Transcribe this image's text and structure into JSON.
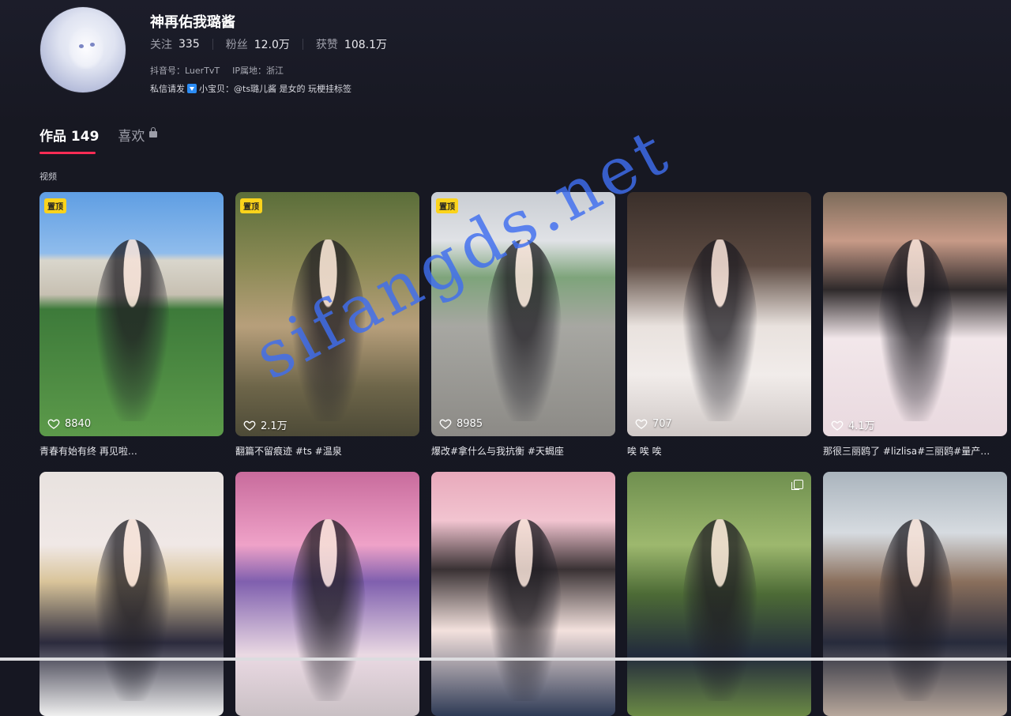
{
  "profile": {
    "nickname": "神再佑我璐酱",
    "stats": [
      {
        "label": "关注",
        "value": "335"
      },
      {
        "label": "粉丝",
        "value": "12.0万"
      },
      {
        "label": "获赞",
        "value": "108.1万"
      }
    ],
    "douyin_id": "抖音号：LuerTvT",
    "ip_location": "IP属地：浙江",
    "bio_prefix": "私信请发",
    "bio_suffix": "小宝贝：@ts璐儿酱 是女的 玩梗挂标签"
  },
  "tabs": {
    "works": "作品 149",
    "likes": "喜欢"
  },
  "section_label": "视频",
  "pin_label": "置顶",
  "videos": [
    {
      "likes": "8840",
      "caption": "青春有始有终 再见啦…",
      "pinned": true,
      "bg": "linear-gradient(180deg,#5f9ee3 0%,#8fbcec 25%,#d9d6cc 28%,#c7c0b2 42%,#3d7a3a 48%,#5c9a4a 100%)"
    },
    {
      "likes": "2.1万",
      "caption": "翻篇不留痕迹 #ts #温泉",
      "pinned": true,
      "bg": "linear-gradient(180deg,#5b6e3a 0%,#8b8a55 30%,#b79f7b 55%,#6d6549 80%,#4d4a37 100%)"
    },
    {
      "likes": "8985",
      "caption": "爆改#拿什么与我抗衡 #天蝎座",
      "pinned": true,
      "bg": "linear-gradient(180deg,#c9cdd3 0%,#e0e2e6 20%,#7ea47b 35%,#a7a7a2 55%,#8c8a86 100%)"
    },
    {
      "likes": "707",
      "caption": "唉 唉 唉",
      "pinned": false,
      "bg": "linear-gradient(180deg,#3a2f2a 0%,#5d4b42 30%,#e9e2de 55%,#f1ecea 75%,#cfc8c6 100%)"
    },
    {
      "likes": "4.1万",
      "caption": "那很三丽鸥了 #lizlisa#三丽鸥#量产…",
      "pinned": false,
      "bg": "linear-gradient(180deg,#7c6b5a 0%,#c79a87 20%,#2f2a2b 40%,#f2e7ea 60%,#e9d9df 100%)"
    },
    {
      "likes": "",
      "caption": "",
      "pinned": false,
      "bg": "linear-gradient(180deg,#e8e2df 0%,#f0e8e6 30%,#d9c49a 45%,#2c2b3d 70%,#efefef 100%)"
    },
    {
      "likes": "",
      "caption": "",
      "pinned": false,
      "bg": "linear-gradient(180deg,#c86b9c 0%,#efa2c8 30%,#7f5fae 45%,#ead9e3 75%,#c9c0c4 100%)"
    },
    {
      "likes": "",
      "caption": "",
      "pinned": false,
      "bg": "linear-gradient(180deg,#e8a9bb 0%,#f2c4d0 20%,#3a3234 40%,#f3e1dd 65%,#2e3a55 100%)"
    },
    {
      "likes": "",
      "caption": "",
      "pinned": false,
      "multi": true,
      "bg": "linear-gradient(180deg,#6f8f4f 0%,#9db86e 30%,#4d6b36 50%,#222a3c 75%,#6b8a45 100%)"
    },
    {
      "likes": "",
      "caption": "",
      "pinned": false,
      "bg": "linear-gradient(180deg,#aab4bd 0%,#d6dbe0 25%,#8a6f5c 45%,#272b3c 70%,#b7a79b 100%)"
    }
  ],
  "watermark": "sifangds.net"
}
